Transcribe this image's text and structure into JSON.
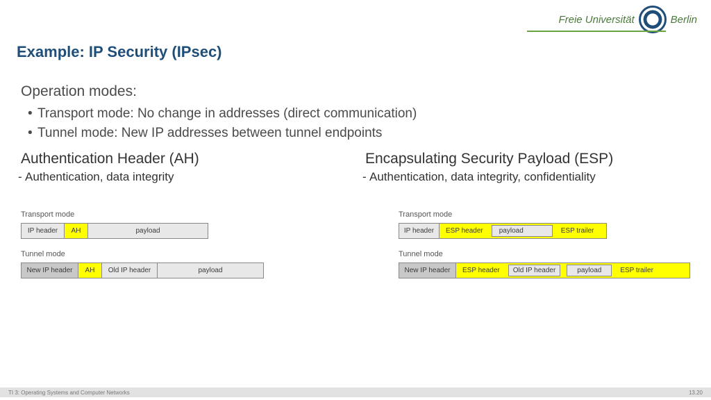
{
  "logo": {
    "text1": "Freie Universität",
    "text2": "Berlin"
  },
  "title": "Example: IP Security (IPsec)",
  "modes_heading": "Operation modes:",
  "bullets": [
    "Transport mode: No change in addresses (direct communication)",
    "Tunnel mode: New IP addresses between tunnel endpoints"
  ],
  "left": {
    "heading": "Authentication Header (AH)",
    "sub": "Authentication, data integrity",
    "transport_label": "Transport mode",
    "tunnel_label": "Tunnel mode",
    "seg": {
      "ip": "IP header",
      "ah": "AH",
      "payload": "payload",
      "newip": "New IP header",
      "oldip": "Old IP header"
    }
  },
  "right": {
    "heading": "Encapsulating Security Payload (ESP)",
    "sub": "Authentication, data integrity, confidentiality",
    "transport_label": "Transport mode",
    "tunnel_label": "Tunnel mode",
    "seg": {
      "ip": "IP header",
      "esph": "ESP header",
      "payload": "payload",
      "espt": "ESP trailer",
      "newip": "New IP header",
      "oldip": "Old IP header"
    }
  },
  "footer": {
    "left": "TI 3: Operating Systems and Computer Networks",
    "right": "13.20"
  }
}
